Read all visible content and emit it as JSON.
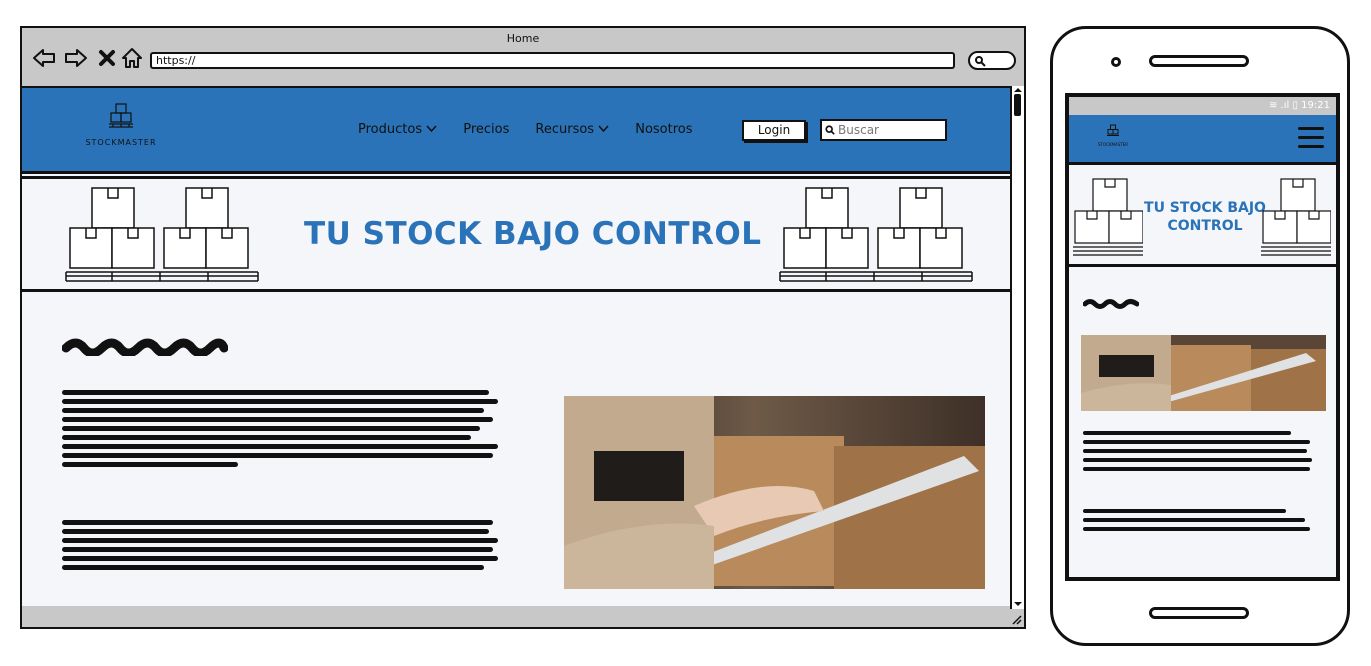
{
  "window": {
    "title": "Home",
    "url": "https://"
  },
  "site": {
    "logo_text": "STOCKMASTER",
    "menu": [
      {
        "label": "Productos",
        "dropdown": true
      },
      {
        "label": "Precios",
        "dropdown": false
      },
      {
        "label": "Recursos",
        "dropdown": true
      },
      {
        "label": "Nosotros",
        "dropdown": false
      }
    ],
    "login_label": "Login",
    "search_placeholder": "Buscar",
    "hero_title": "TU STOCK BAJO CONTROL"
  },
  "mobile": {
    "status_time": "19:21",
    "logo_text": "STOCKMASTER",
    "hero_title": "TU STOCK BAJO CONTROL"
  },
  "colors": {
    "brand_blue": "#2a73b8",
    "page_bg": "#f4f6f9",
    "chrome_gray": "#c8c8c8",
    "ink": "#111111"
  }
}
